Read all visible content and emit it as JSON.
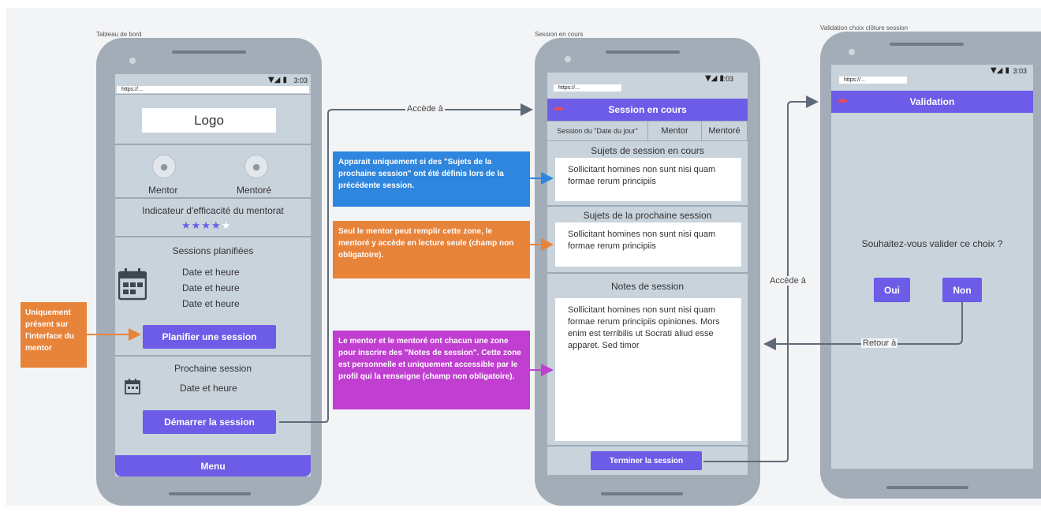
{
  "screens": {
    "dashboard": {
      "label": "Tableau de bord",
      "time": "3:03",
      "status_icons": "▼◢ ▮",
      "url": "https://...",
      "logo": "Logo",
      "mentor_label": "Mentor",
      "mentee_label": "Mentoré",
      "indicator_title": "Indicateur d'efficacité du mentorat",
      "rating": {
        "filled": 4,
        "total": 5
      },
      "sessions_title": "Sessions planifiées",
      "sessions": [
        "Date et heure",
        "Date et heure",
        "Date et heure"
      ],
      "plan_button": "Planifier une session",
      "next_title": "Prochaine session",
      "next_date": "Date et heure",
      "start_button": "Démarrer la session",
      "menu": "Menu"
    },
    "session": {
      "label": "Session en cours",
      "time": "3:03",
      "status_icons": "▼◢ ▮",
      "url": "https://...",
      "header": "Session en cours",
      "tabs": [
        "Session du \"Date du jour\"",
        "Mentor",
        "Mentoré"
      ],
      "current_topics_title": "Sujets de session en cours",
      "current_topics_text": "Sollicitant homines non sunt nisi quam formae rerum principiis",
      "next_topics_title": "Sujets de la prochaine session",
      "next_topics_text": "Sollicitant homines non sunt nisi quam formae rerum principiis",
      "notes_title": "Notes de session",
      "notes_text": "Sollicitant homines non sunt nisi quam formae rerum principiis opiniones. Mors enim est terribilis ut Socrati aliud esse apparet. Sed timor",
      "end_button": "Terminer la session"
    },
    "validation": {
      "label": "Validation choix clôture session",
      "time": "3:03",
      "status_icons": "▼◢ ▮",
      "url": "https://...",
      "header": "Validation",
      "question": "Souhaitez-vous valider ce choix ?",
      "yes": "Oui",
      "no": "Non"
    }
  },
  "callouts": {
    "mentor_only": "Uniquement présent sur l'interface du mentor",
    "appears_if": "Apparait uniquement si des \"Sujets de la prochaine session\" ont été définis lors de la précédente session.",
    "mentor_fill": "Seul le mentor peut remplir cette zone, le mentoré y accède en lecture seule (champ non obligatoire).",
    "notes_info": "Le mentor et le mentoré ont chacun une zone pour inscrire des \"Notes de session\". Cette zone est personnelle et uniquement accessible par le profil qui la renseigne (champ non obligatoire)."
  },
  "arrows": {
    "access_1": "Accède à",
    "access_2": "Accède à",
    "back": "Retour à"
  },
  "colors": {
    "accent": "#6c5ce7",
    "callout_orange": "#e8833a",
    "callout_blue": "#2e86de",
    "callout_magenta": "#c03fd0",
    "back_icon": "#e74c5b",
    "star_filled": "#6c5ce7",
    "star_empty": "#ffffff"
  }
}
